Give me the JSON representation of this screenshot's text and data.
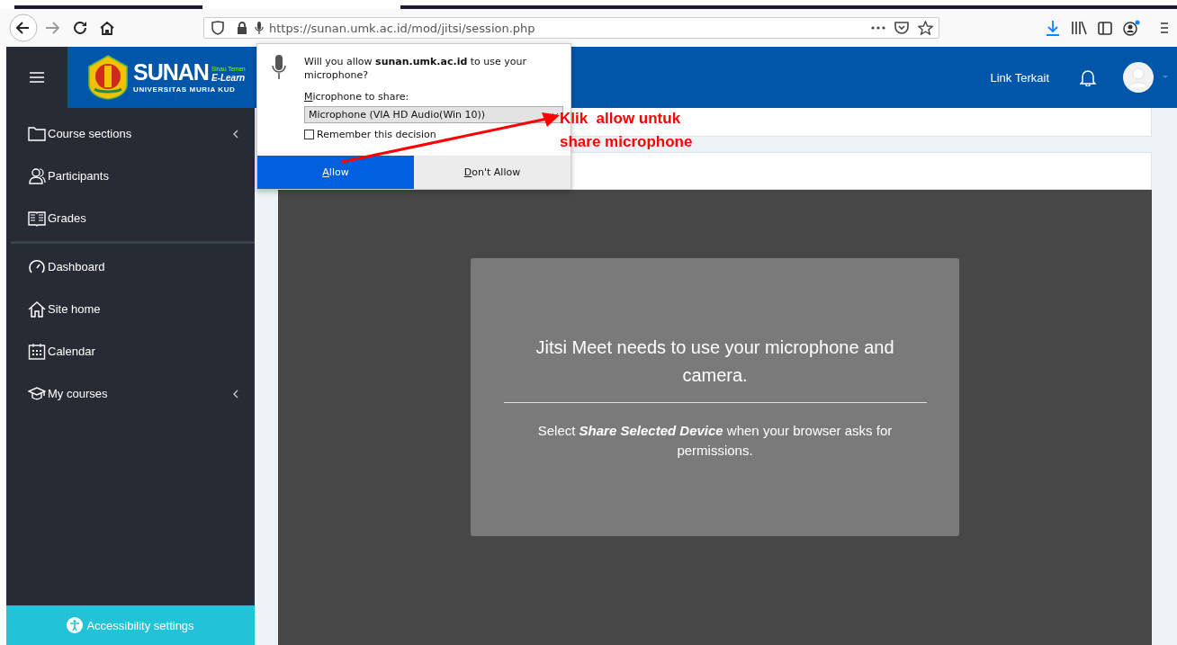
{
  "browser": {
    "url": "https://sunan.umk.ac.id/mod/jitsi/session.php"
  },
  "header": {
    "brand": "SUNAN",
    "tagline": "Sinau Temen",
    "subtitle": "E-Learn",
    "university": "UNIVERSITAS MURIA KUD",
    "link": "Link Terkait"
  },
  "sidebar": {
    "groups": [
      [
        {
          "label": "Course sections",
          "kind": "section"
        },
        {
          "label": "Participants",
          "kind": "link"
        },
        {
          "label": "Grades",
          "kind": "link"
        }
      ],
      [
        {
          "label": "Dashboard",
          "kind": "link"
        },
        {
          "label": "Site home",
          "kind": "link"
        },
        {
          "label": "Calendar",
          "kind": "link"
        },
        {
          "label": "My courses",
          "kind": "section"
        }
      ]
    ],
    "footer": "Accessibility settings"
  },
  "permission_popup": {
    "question": "Will you allow **sunan.umk.ac.id** to use your microphone?",
    "device_label": "Microphone to share:",
    "device": "Microphone (VIA HD Audio(Win 10))",
    "remember": {
      "label": "Remember this decision",
      "checked": false
    },
    "buttons": [
      {
        "label": "Allow",
        "kind": "primary"
      },
      {
        "label": "Don't Allow",
        "kind": "secondary"
      }
    ]
  },
  "annotation": {
    "lines": [
      "Klik  allow untuk",
      "share microphone"
    ]
  },
  "jitsi": {
    "title": "Jitsi Meet needs to use your microphone and camera.",
    "hint": "Select **Share Selected Device** when your browser asks for permissions."
  }
}
